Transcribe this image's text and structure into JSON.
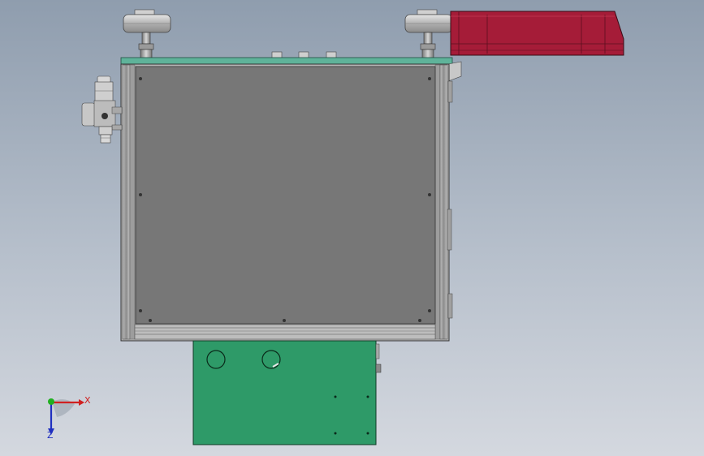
{
  "viewport": {
    "background_top": "#8f9dae",
    "background_bottom": "#d4d8df"
  },
  "model": {
    "panel_color": "#777777",
    "frame_color": "#9a9a9a",
    "top_plate_color": "#5fb39a",
    "green_box_color": "#2e9a68",
    "red_housing_color": "#a51c38"
  },
  "triad": {
    "x_label": "X",
    "z_label": "Z",
    "x_color": "#d02020",
    "y_color": "#20b020",
    "z_color": "#2030c0"
  }
}
